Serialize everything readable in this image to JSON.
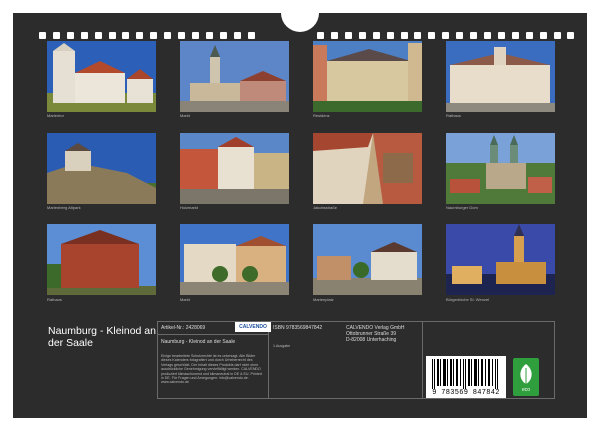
{
  "calendar": {
    "title": "Naumburg - Kleinod an der Saale",
    "photos": [
      {
        "caption": "Marientor"
      },
      {
        "caption": "Markt"
      },
      {
        "caption": "Residenz"
      },
      {
        "caption": "Rathaus"
      },
      {
        "caption": "Marienberg Altpark"
      },
      {
        "caption": "Holzmarkt"
      },
      {
        "caption": "Jakobsstraße"
      },
      {
        "caption": "Naumburger Dom"
      },
      {
        "caption": "Rathaus"
      },
      {
        "caption": "Markt"
      },
      {
        "caption": "Marienplatz"
      },
      {
        "caption": "Bürgerkirche St. Wenzel"
      }
    ]
  },
  "info": {
    "article_no": "Artikel-Nr.: 2428069",
    "publisher_logo": "CALVENDO",
    "isbn": "ISBN 9783569847842",
    "publisher_lines": [
      "CALVENDO Verlag GmbH",
      "Ottobrunner Straße 39",
      "D-82008 Unterhaching"
    ],
    "calendar_name": "Naumburg - Kleinod an der Saale",
    "edition": "1.Ausgabe",
    "legal_text": "Einige bearbeitete Schutzrechte ist es untersagt. Alle Bilder dieses Kalenders fotografiert und durch Urheberrecht des Verlags ge­schützt. Der Inhalt dieses Produkts darf nicht ohne ausdrückliche Ge­nehmigung vervielfältigt werden. CALVENDO produziert klimaschonend und klimaneutral in DE & EU. Printed in DE. Für Fragen und Anregungen: info@calvendo.de. www.calvendo.de",
    "barcode_number": "9 783569 847842",
    "eco_label": "eco"
  }
}
